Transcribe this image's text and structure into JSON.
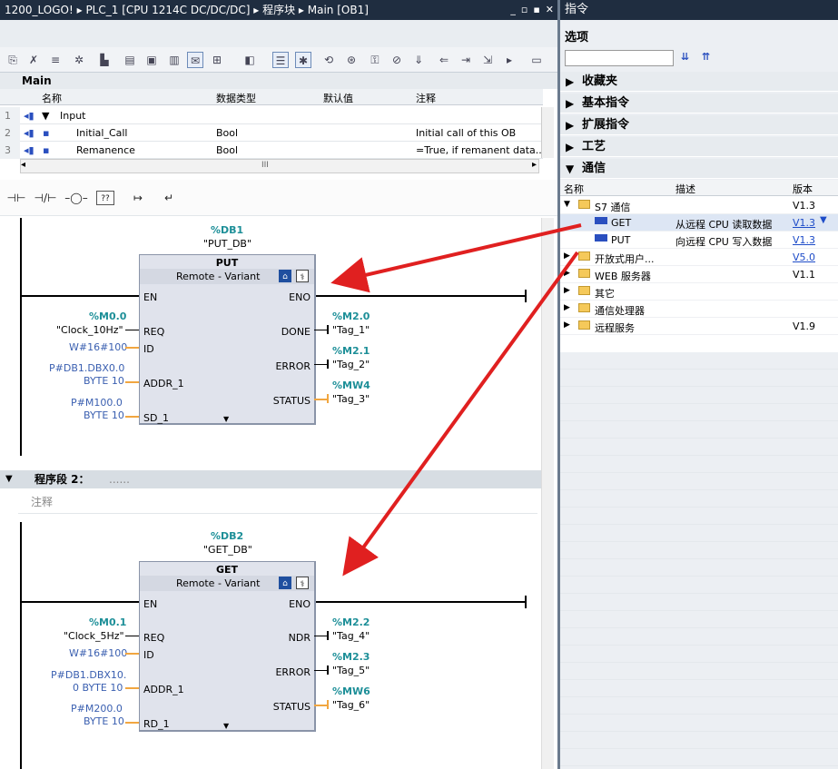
{
  "window": {
    "breadcrumb": "1200_LOGO! ▸ PLC_1 [CPU 1214C DC/DC/DC] ▸ 程序块 ▸ Main [OB1]",
    "controls": [
      "_",
      "▫",
      "▪",
      "✕"
    ]
  },
  "right_panel": {
    "title": "指令",
    "options_label": "选项",
    "sections": [
      "收藏夹",
      "基本指令",
      "扩展指令",
      "工艺",
      "通信"
    ]
  },
  "block": {
    "name": "Main"
  },
  "interface": {
    "headers": [
      "名称",
      "数据类型",
      "默认值",
      "注释"
    ],
    "rows": [
      {
        "num": "1",
        "name": "Input",
        "type": "",
        "default": "",
        "comment": ""
      },
      {
        "num": "2",
        "name": "Initial_Call",
        "type": "Bool",
        "default": "",
        "comment": "Initial call of this OB"
      },
      {
        "num": "3",
        "name": "Remanence",
        "type": "Bool",
        "default": "",
        "comment": "=True, if remanent data..."
      }
    ],
    "scroll": "III"
  },
  "ladder_tools": [
    "⊣⊢",
    "⊣/⊢",
    "–◯–",
    "??",
    "↦",
    "↵"
  ],
  "network1": {
    "db": "%DB1",
    "db_name": "\"PUT_DB\"",
    "block": "PUT",
    "remote": "Remote",
    "variant": "Variant",
    "in_pins": [
      "EN",
      "REQ",
      "ID",
      "ADDR_1",
      "SD_1"
    ],
    "out_pins": [
      "ENO",
      "DONE",
      "ERROR",
      "STATUS"
    ],
    "req_addr": "%M0.0",
    "req_tag": "\"Clock_10Hz\"",
    "id_val": "W#16#100",
    "addr_1": "P#DB1.DBX0.0",
    "addr_2": "BYTE 10",
    "sd_1": "P#M100.0",
    "sd_2": "BYTE 10",
    "done_addr": "%M2.0",
    "done_tag": "\"Tag_1\"",
    "err_addr": "%M2.1",
    "err_tag": "\"Tag_2\"",
    "st_addr": "%MW4",
    "st_tag": "\"Tag_3\""
  },
  "network2": {
    "header": "程序段 2：",
    "dots": "......",
    "comment": "注释",
    "db": "%DB2",
    "db_name": "\"GET_DB\"",
    "block": "GET",
    "remote": "Remote",
    "variant": "Variant",
    "in_pins": [
      "EN",
      "REQ",
      "ID",
      "ADDR_1",
      "RD_1"
    ],
    "out_pins": [
      "ENO",
      "NDR",
      "ERROR",
      "STATUS"
    ],
    "req_addr": "%M0.1",
    "req_tag": "\"Clock_5Hz\"",
    "id_val": "W#16#100",
    "addr_1": "P#DB1.DBX10.",
    "addr_2": "0 BYTE 10",
    "rd_1": "P#M200.0",
    "rd_2": "BYTE 10",
    "ndr_addr": "%M2.2",
    "ndr_tag": "\"Tag_4\"",
    "err_addr": "%M2.3",
    "err_tag": "\"Tag_5\"",
    "st_addr": "%MW6",
    "st_tag": "\"Tag_6\""
  },
  "comm_tree": {
    "headers": [
      "名称",
      "描述",
      "版本"
    ],
    "rows": [
      {
        "name": "S7 通信",
        "desc": "",
        "ver": "V1.3",
        "kind": "folder-open"
      },
      {
        "name": "GET",
        "desc": "从远程 CPU 读取数据",
        "ver": "V1.3",
        "kind": "instr"
      },
      {
        "name": "PUT",
        "desc": "向远程 CPU 写入数据",
        "ver": "V1.3",
        "kind": "instr"
      },
      {
        "name": "开放式用户...",
        "desc": "",
        "ver": "V5.0",
        "kind": "folder"
      },
      {
        "name": "WEB 服务器",
        "desc": "",
        "ver": "V1.1",
        "kind": "folder"
      },
      {
        "name": "其它",
        "desc": "",
        "ver": "",
        "kind": "folder"
      },
      {
        "name": "通信处理器",
        "desc": "",
        "ver": "",
        "kind": "folder"
      },
      {
        "name": "远程服务",
        "desc": "",
        "ver": "V1.9",
        "kind": "folder"
      }
    ]
  },
  "colors": {
    "titlebar": "#1f2d40",
    "teal": "#1d8f98",
    "operand_blue": "#3a5fb0",
    "arrow": "#e02020",
    "wire": "#f1a640"
  }
}
